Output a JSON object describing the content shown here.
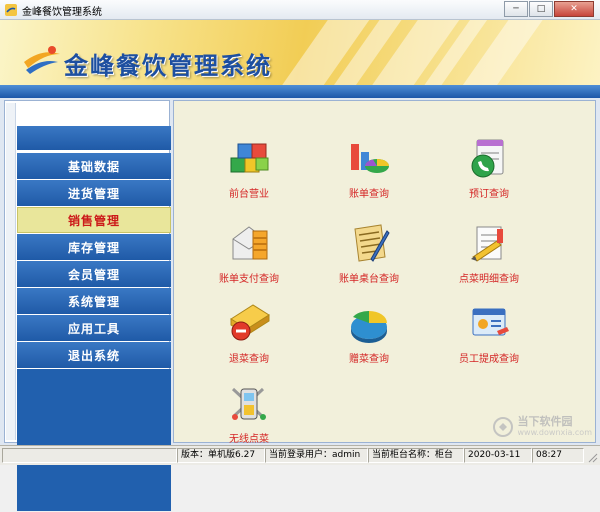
{
  "window": {
    "title": "金峰餐饮管理系统",
    "controls": {
      "minimize": "─",
      "maximize": "□",
      "close": "✕"
    }
  },
  "banner": {
    "title": "金峰餐饮管理系统",
    "logo_icon": "swoosh-logo-icon"
  },
  "sidebar": {
    "items": [
      {
        "label": "基础数据",
        "active": false
      },
      {
        "label": "进货管理",
        "active": false
      },
      {
        "label": "销售管理",
        "active": true
      },
      {
        "label": "库存管理",
        "active": false
      },
      {
        "label": "会员管理",
        "active": false
      },
      {
        "label": "系统管理",
        "active": false
      },
      {
        "label": "应用工具",
        "active": false
      },
      {
        "label": "退出系统",
        "active": false
      }
    ]
  },
  "functions": [
    {
      "label": "前台营业",
      "icon": "cubes-icon"
    },
    {
      "label": "账单查询",
      "icon": "chart-icon"
    },
    {
      "label": "预订查询",
      "icon": "phone-book-icon"
    },
    {
      "label": "账单支付查询",
      "icon": "payment-envelope-icon"
    },
    {
      "label": "账单桌台查询",
      "icon": "document-pen-icon"
    },
    {
      "label": "点菜明细查询",
      "icon": "order-detail-icon"
    },
    {
      "label": "退菜查询",
      "icon": "cancel-item-icon"
    },
    {
      "label": "赠菜查询",
      "icon": "gift-pie-icon"
    },
    {
      "label": "员工提成查询",
      "icon": "employee-card-icon"
    },
    {
      "label": "无线点菜",
      "icon": "wireless-device-icon"
    }
  ],
  "statusbar": {
    "version": "版本：单机版6.27",
    "user": "当前登录用户：admin",
    "station": "当前柜台名称：柜台",
    "date": "2020-03-11",
    "time": "08:27"
  },
  "watermark": {
    "name": "当下软件园",
    "url": "www.downxia.com"
  },
  "colors": {
    "nav_blue": "#2160ae",
    "nav_active_bg": "#e9e69b",
    "nav_active_text": "#cc1a1a",
    "function_label": "#d42525",
    "content_bg": "#f2f0db",
    "banner_title": "#1d4fa0"
  }
}
